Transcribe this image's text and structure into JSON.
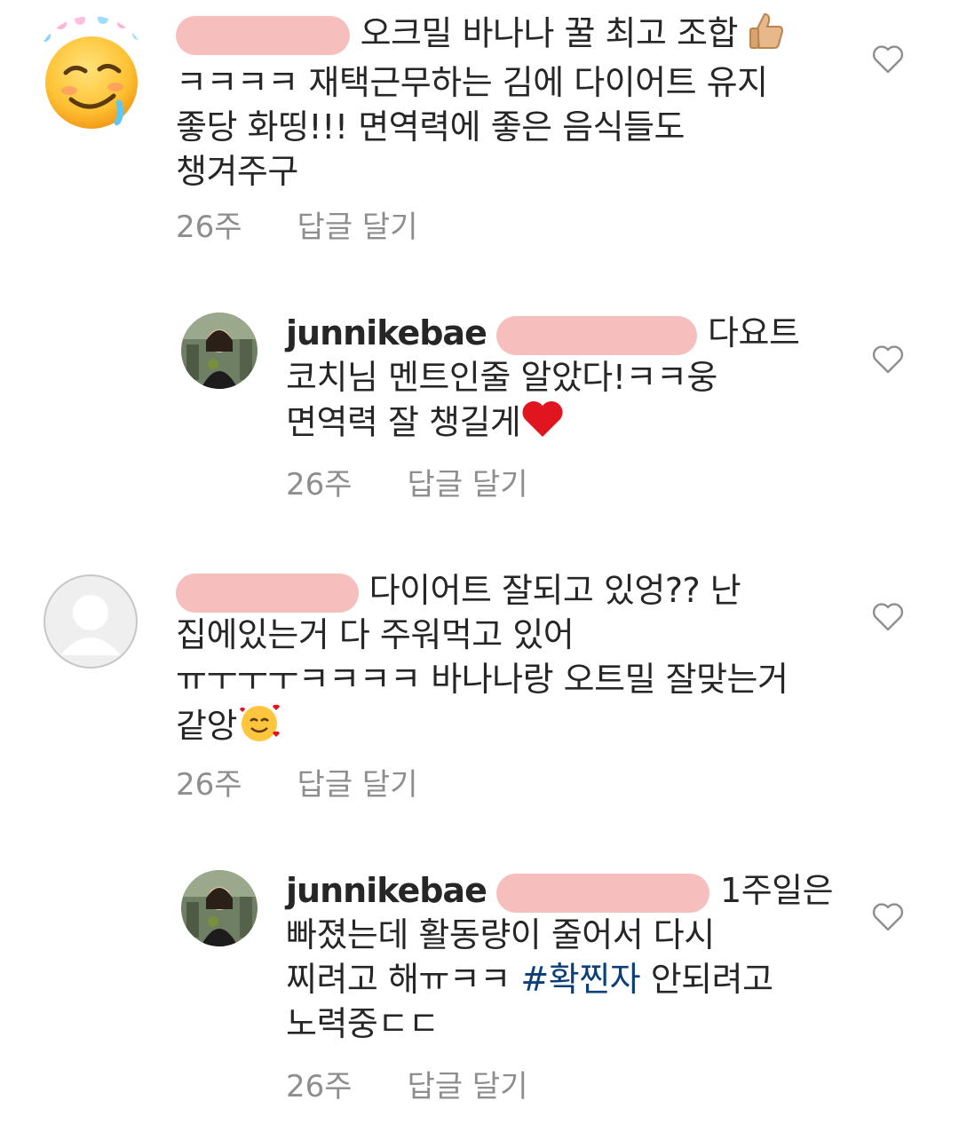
{
  "comments": [
    {
      "text_line1": " 오크밀 바나나 꿀 최고 조합 ",
      "text_line2": "ㅋㅋㅋㅋ 재택근무하는 김에 다이어트 유지",
      "text_line3": "좋당 화띵!!! 면역력에 좋은 음식들도",
      "text_line4": "챙겨주구",
      "time": "26주",
      "reply": "답글 달기",
      "emoji_inline": "thumbs-up-icon",
      "avatar_icon": "drooling-face-icon"
    },
    {
      "username": "junnikebae",
      "text_line1": " 다요트",
      "text_line2": "코치님 멘트인줄 알았다!ㅋㅋ웅",
      "text_line3": "면역력 잘 챙길게",
      "time": "26주",
      "reply": "답글 달기",
      "emoji_inline": "red-heart-icon"
    },
    {
      "text_line1": " 다이어트 잘되고 있엉?? 난",
      "text_line2": "집에있는거 다 주워먹고 있어",
      "text_line3": "ㅠㅜㅜㅜㅋㅋㅋㅋ 바나나랑 오트밀 잘맞는거",
      "text_line4": "같앙",
      "time": "26주",
      "reply": "답글 달기",
      "emoji_inline": "smiling-face-with-hearts-icon"
    },
    {
      "username": "junnikebae",
      "text_line1": " 1주일은",
      "text_line2": "빠졌는데 활동량이 줄어서 다시",
      "text_line3_a": "찌려고 해ㅠㅋㅋ ",
      "hashtag": "#확찐자",
      "text_line3_b": " 안되려고",
      "text_line4": "노력중ㄷㄷ",
      "time": "26주",
      "reply": "답글 달기"
    }
  ],
  "colors": {
    "text": "#262626",
    "meta": "#8e8e8e",
    "hashtag": "#0a3f7a",
    "redaction": "#f6b7b7"
  }
}
